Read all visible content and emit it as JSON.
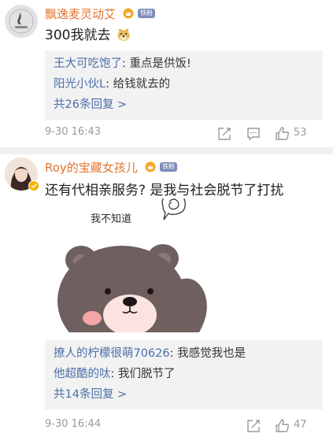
{
  "comments": [
    {
      "username": "飘逸麦灵动艾",
      "fan_badge": "铁粉",
      "text": "300我就去",
      "emoji": "doge-icon",
      "replies": [
        {
          "user": "王大可吃饱了",
          "text": ": 重点是供饭!"
        },
        {
          "user": "阳光小伙L",
          "text": ": 给钱就去的"
        }
      ],
      "more_replies": "共26条回复 >",
      "time": "9-30 16:43",
      "likes": "53"
    },
    {
      "username": "Roy的宝藏女孩儿",
      "fan_badge": "铁粉",
      "text": "还有代相亲服务? 是我与社会脱节了打扰",
      "sticker_caption": "我不知道",
      "replies": [
        {
          "user": "撩人的柠檬很萌70626",
          "text": ": 我感觉我也是"
        },
        {
          "user": "他超酷的呔",
          "text": ": 我们脱节了"
        }
      ],
      "more_replies": "共14条回复 >",
      "time": "9-30 16:44",
      "likes": "47"
    }
  ],
  "colors": {
    "username": "#e3762f",
    "link": "#4a6fa8",
    "meta": "#9a9a9a",
    "reply_bg": "#f2f2f2",
    "fan_badge_bg": "#7d8cb8",
    "vip_gold": "#f5a623"
  }
}
